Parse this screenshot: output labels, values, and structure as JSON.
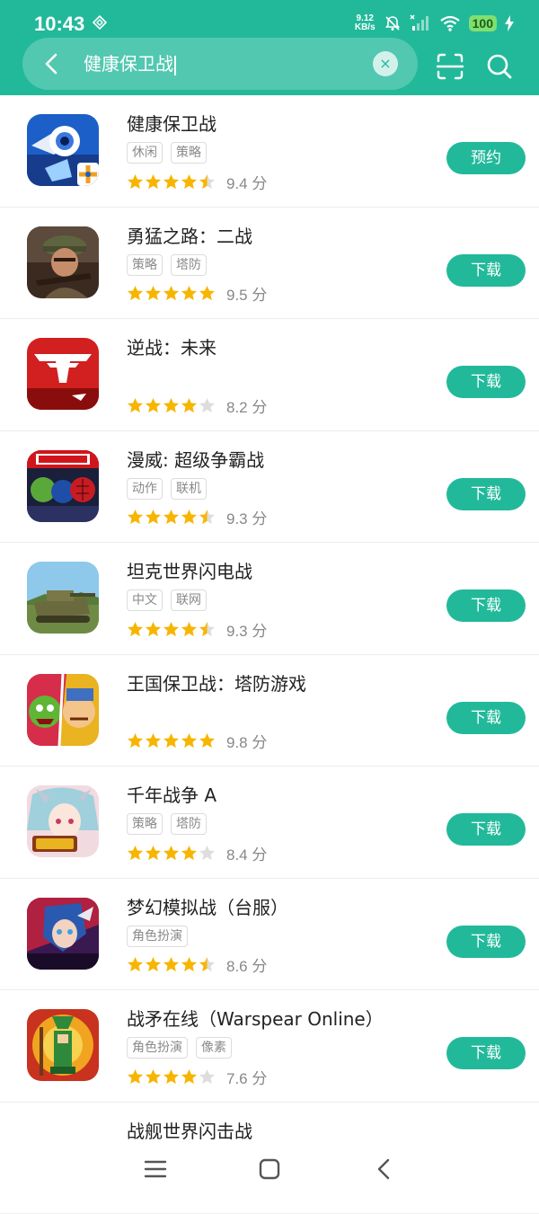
{
  "status": {
    "time": "10:43",
    "net_speed_value": "9.12",
    "net_speed_unit": "KB/s",
    "battery": "100"
  },
  "search": {
    "query": "健康保卫战"
  },
  "apps": [
    {
      "name": "健康保卫战",
      "tags": [
        "休闲",
        "策略"
      ],
      "rating": 4.5,
      "score": "9.4 分",
      "button": "预约"
    },
    {
      "name": "勇猛之路：二战",
      "tags": [
        "策略",
        "塔防"
      ],
      "rating": 5,
      "score": "9.5 分",
      "button": "下载"
    },
    {
      "name": "逆战：未来",
      "tags": [],
      "rating": 4,
      "score": "8.2 分",
      "button": "下载"
    },
    {
      "name": "漫威: 超级争霸战",
      "tags": [
        "动作",
        "联机"
      ],
      "rating": 4.5,
      "score": "9.3 分",
      "button": "下载"
    },
    {
      "name": "坦克世界闪电战",
      "tags": [
        "中文",
        "联网"
      ],
      "rating": 4.5,
      "score": "9.3 分",
      "button": "下载"
    },
    {
      "name": "王国保卫战：塔防游戏",
      "tags": [],
      "rating": 5,
      "score": "9.8 分",
      "button": "下载"
    },
    {
      "name": "千年战争 A",
      "tags": [
        "策略",
        "塔防"
      ],
      "rating": 4,
      "score": "8.4 分",
      "button": "下载"
    },
    {
      "name": "梦幻模拟战（台服）",
      "tags": [
        "角色扮演"
      ],
      "rating": 4.5,
      "score": "8.6 分",
      "button": "下载"
    },
    {
      "name": "战矛在线（Warspear Online）",
      "tags": [
        "角色扮演",
        "像素"
      ],
      "rating": 4,
      "score": "7.6 分",
      "button": "下载"
    },
    {
      "name": "战舰世界闪击战",
      "tags": [],
      "rating": null,
      "score": "",
      "button": ""
    }
  ],
  "colors": {
    "accent": "#22b99a",
    "star": "#f7b500",
    "star_empty": "#dddddd"
  },
  "icons": [
    "back-arrow-icon",
    "clear-icon",
    "scan-icon",
    "search-icon",
    "menu-icon",
    "home-icon",
    "back-nav-icon"
  ]
}
